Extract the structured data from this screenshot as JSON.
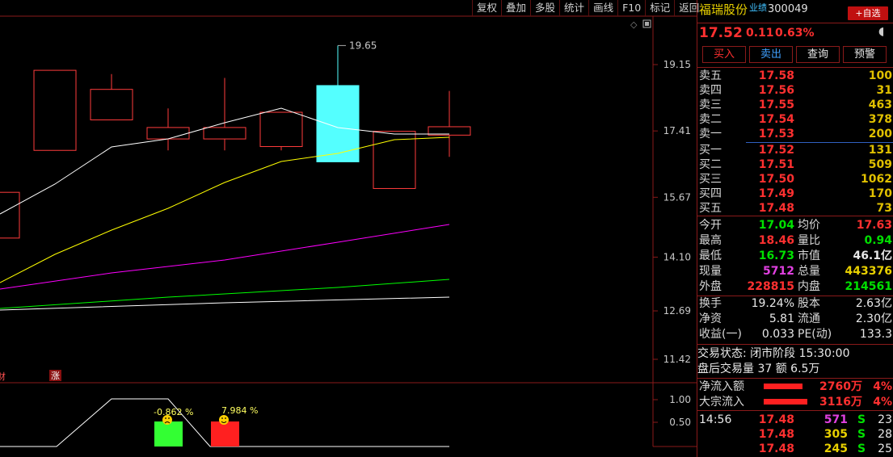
{
  "toolbar": [
    "复权",
    "叠加",
    "多股",
    "统计",
    "画线",
    "F10",
    "标记",
    "返回"
  ],
  "chart": {
    "price_axis": [
      "19.15",
      "17.41",
      "15.67",
      "14.10",
      "12.69",
      "11.42"
    ],
    "peak_label": "19.65",
    "markers": [
      "财",
      "涨"
    ],
    "sub_axis": [
      "1.00",
      "0.50"
    ],
    "sub_labels": [
      "-0.862 %",
      "7.984 %"
    ],
    "colors": {
      "up": "#ff3c3c",
      "down": "#54ffff",
      "ma5": "#ffffff",
      "ma10": "#ffff00",
      "ma20": "#ff00ff",
      "ma60": "#00ff00",
      "ma120": "#ffffff"
    }
  },
  "chart_data": {
    "type": "candlestick",
    "candles": [
      {
        "open": 14.6,
        "close": 15.8,
        "high": 15.8,
        "low": 14.6,
        "direction": "up"
      },
      {
        "open": 16.9,
        "close": 19.0,
        "high": 19.0,
        "low": 16.9,
        "direction": "up"
      },
      {
        "open": 17.7,
        "close": 18.5,
        "high": 18.9,
        "low": 17.7,
        "direction": "up"
      },
      {
        "open": 17.2,
        "close": 17.5,
        "high": 18.0,
        "low": 16.9,
        "direction": "up"
      },
      {
        "open": 17.2,
        "close": 17.5,
        "high": 18.8,
        "low": 16.9,
        "direction": "up"
      },
      {
        "open": 17.0,
        "close": 17.9,
        "high": 17.9,
        "low": 16.9,
        "direction": "up"
      },
      {
        "open": 18.6,
        "close": 16.6,
        "high": 19.65,
        "low": 16.6,
        "direction": "down"
      },
      {
        "open": 15.9,
        "close": 17.4,
        "high": 17.4,
        "low": 15.9,
        "direction": "up"
      },
      {
        "open": 17.3,
        "close": 17.52,
        "high": 18.46,
        "low": 16.73,
        "direction": "up"
      }
    ],
    "y_ticks": [
      19.15,
      17.41,
      15.67,
      14.1,
      12.69,
      11.42
    ]
  },
  "stock": {
    "name": "福瑞股份",
    "tag": "业绩",
    "code": "300049",
    "add_label": "+自选",
    "price": "17.52",
    "change": "0.11",
    "pct": "0.63%"
  },
  "actions": [
    "买入",
    "卖出",
    "查询",
    "预警"
  ],
  "asks": [
    {
      "label": "卖五",
      "price": "17.58",
      "vol": "100"
    },
    {
      "label": "卖四",
      "price": "17.56",
      "vol": "31"
    },
    {
      "label": "卖三",
      "price": "17.55",
      "vol": "463"
    },
    {
      "label": "卖二",
      "price": "17.54",
      "vol": "378"
    },
    {
      "label": "卖一",
      "price": "17.53",
      "vol": "200"
    }
  ],
  "bids": [
    {
      "label": "买一",
      "price": "17.52",
      "vol": "131"
    },
    {
      "label": "买二",
      "price": "17.51",
      "vol": "509"
    },
    {
      "label": "买三",
      "price": "17.50",
      "vol": "1062"
    },
    {
      "label": "买四",
      "price": "17.49",
      "vol": "170"
    },
    {
      "label": "买五",
      "price": "17.48",
      "vol": "73"
    }
  ],
  "stats": [
    {
      "l1": "今开",
      "v1": "17.04",
      "c1": "green",
      "l2": "均价",
      "v2": "17.63",
      "c2": "red"
    },
    {
      "l1": "最高",
      "v1": "18.46",
      "c1": "red",
      "l2": "量比",
      "v2": "0.94",
      "c2": "green"
    },
    {
      "l1": "最低",
      "v1": "16.73",
      "c1": "green",
      "l2": "市值",
      "v2": "46.1亿",
      "c2": "white"
    },
    {
      "l1": "现量",
      "v1": "5712",
      "c1": "purple",
      "l2": "总量",
      "v2": "443376",
      "c2": "yellow"
    },
    {
      "l1": "外盘",
      "v1": "228815",
      "c1": "red",
      "l2": "内盘",
      "v2": "214561",
      "c2": "green"
    }
  ],
  "stats2": [
    {
      "l1": "换手",
      "v1": "19.24%",
      "l2": "股本",
      "v2": "2.63亿"
    },
    {
      "l1": "净资",
      "v1": "5.81",
      "l2": "流通",
      "v2": "2.30亿"
    },
    {
      "l1": "收益(一)",
      "v1": "0.033",
      "l2": "PE(动)",
      "v2": "133.3"
    }
  ],
  "status": {
    "line1": "交易状态: 闭市阶段 15:30:00",
    "line2": "盘后交易量 37 额 6.5万"
  },
  "flows": [
    {
      "label": "净流入额",
      "value": "2760万",
      "pct": "4%"
    },
    {
      "label": "大宗流入",
      "value": "3116万",
      "pct": "4%"
    }
  ],
  "ticks": [
    {
      "time": "14:56",
      "price": "17.48",
      "vol": "571",
      "side": "S",
      "n": "23"
    },
    {
      "time": "",
      "price": "17.48",
      "vol": "305",
      "side": "S",
      "n": "28"
    },
    {
      "time": "",
      "price": "17.48",
      "vol": "245",
      "side": "S",
      "n": "25"
    }
  ]
}
